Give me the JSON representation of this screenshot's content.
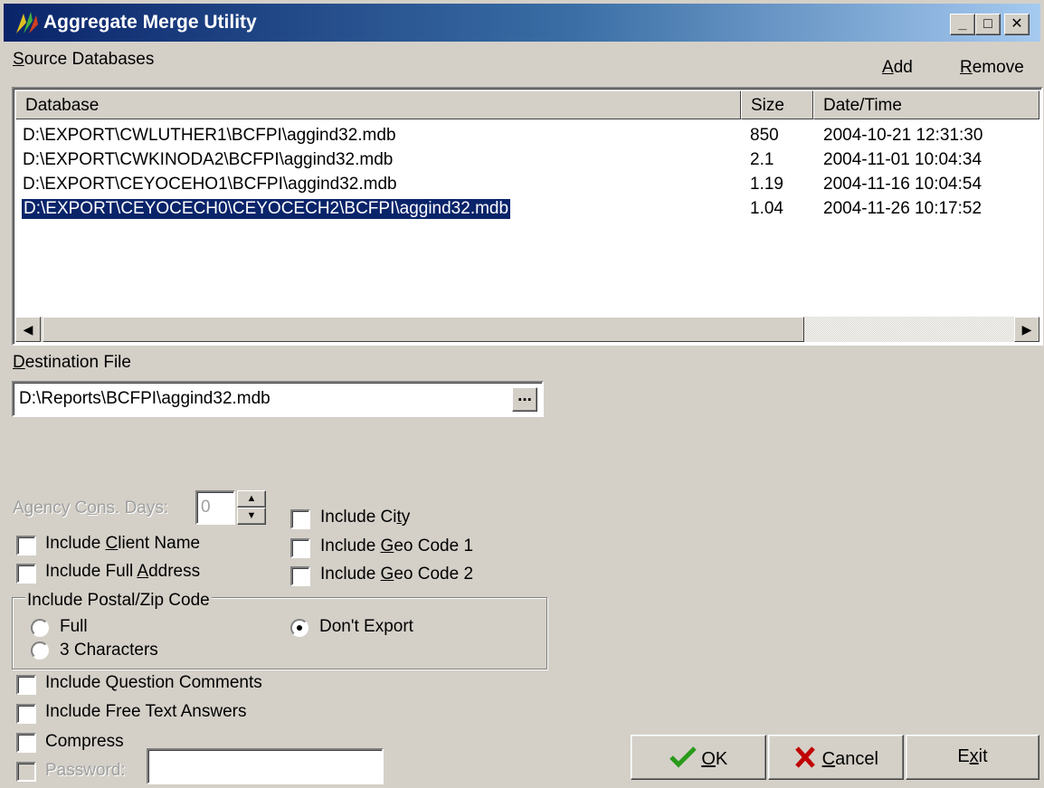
{
  "window": {
    "title": "Aggregate Merge Utility",
    "minimize": "_",
    "maximize": "□",
    "close": "✕"
  },
  "source": {
    "label_underline": "S",
    "label_rest": "ource Databases",
    "add_underline": "A",
    "add_rest": "dd",
    "remove_underline": "R",
    "remove_rest": "emove"
  },
  "list": {
    "columns": [
      "Database",
      "Size",
      "Date/Time"
    ],
    "rows": [
      {
        "database": "D:\\EXPORT\\CWLUTHER1\\BCFPI\\aggind32.mdb",
        "size": "850",
        "datetime": "2004-10-21 12:31:30"
      },
      {
        "database": "D:\\EXPORT\\CWKINODA2\\BCFPI\\aggind32.mdb",
        "size": "2.1",
        "datetime": "2004-11-01 10:04:34"
      },
      {
        "database": "D:\\EXPORT\\CEYOCEHO1\\BCFPI\\aggind32.mdb",
        "size": "1.19",
        "datetime": "2004-11-16 10:04:54"
      },
      {
        "database": "D:\\EXPORT\\CEYOCECH0\\CEYOCECH2\\BCFPI\\aggind32.mdb",
        "size": "1.04",
        "datetime": "2004-11-26 10:17:52"
      }
    ],
    "selected_row": 3
  },
  "destination": {
    "label_underline": "D",
    "label_rest": "estination File",
    "value": "D:\\Reports\\BCFPI\\aggind32.mdb",
    "browse": "..."
  },
  "options": {
    "agency_pre": "Agency C",
    "agency_ul": "o",
    "agency_post": "ns. Days:",
    "agency_value": "0",
    "client_pre": "Include ",
    "client_ul": "C",
    "client_post": "lient Name",
    "address_pre": "Include Full ",
    "address_ul": "A",
    "address_post": "ddress",
    "city_pre": "Include Ci",
    "city_ul": "t",
    "city_post": "y",
    "geo1_pre": "Include ",
    "geo1_ul": "G",
    "geo1_post": "eo Code 1",
    "geo2_pre": "Include ",
    "geo2_ul": "G",
    "geo2_post": "eo Code 2",
    "postal_group": "Include Postal/Zip Code",
    "postal_full": "Full",
    "postal_3chars": "3 Characters",
    "postal_dont": "Don't Export",
    "question_comments": "Include Question Comments",
    "free_text": "Include Free Text Answers",
    "compress": "Compress",
    "password": "Password:"
  },
  "buttons": {
    "ok_ul": "O",
    "ok_rest": "K",
    "cancel_ul": "C",
    "cancel_rest": "ancel",
    "exit_pre": "E",
    "exit_ul": "x",
    "exit_post": "it"
  },
  "colors": {
    "face": "#d4d0c8",
    "title_start": "#0a246a",
    "title_end": "#a6caf0",
    "selection": "#0a246a",
    "ok_check": "#2a9a1a",
    "cancel_x": "#c00000"
  }
}
